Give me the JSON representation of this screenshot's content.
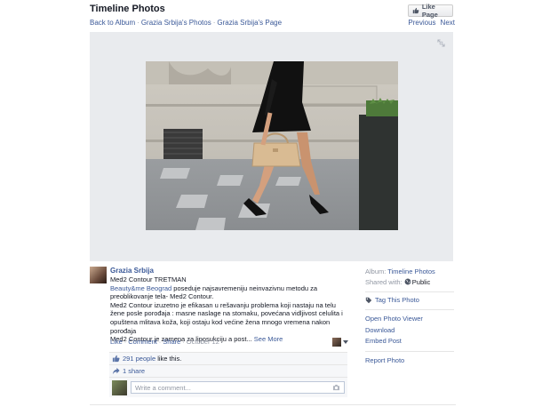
{
  "header": {
    "title": "Timeline Photos",
    "breadcrumbs": [
      "Back to Album",
      "Grazia Srbija's Photos",
      "Grazia Srbija's Page"
    ],
    "like_page_label": "Like Page",
    "prev_label": "Previous",
    "next_label": "Next"
  },
  "post": {
    "author": "Grazia Srbija",
    "line1": "Med2 Contour TRETMAN",
    "mention": "Beauty&me Beograd",
    "line2_rest": " poseduje najsavremeniju neinvazivnu metodu za preoblikovanje tela- Med2 Contour.",
    "line3": "Med2 Contour izuzetno je efikasan u rešavanju problema koji nastaju na telu žene posle porođaja : masne naslage na stomaku, povećana vidljivost celulita i opuštena mlitava koža, koji ostaju kod većine žena mnogo vremena nakon porođaja",
    "line4": "Med2 Contour je zamena za liposukciju a post...",
    "see_more": "See More",
    "actions": {
      "like": "Like",
      "comment": "Comment",
      "share": "Share",
      "date": "October 12"
    }
  },
  "ufi": {
    "likes_link": "291 people",
    "likes_rest": " like this.",
    "shares": "1 share",
    "comment_placeholder": "Write a comment..."
  },
  "sidebar": {
    "album_label": "Album:",
    "album_value": "Timeline Photos",
    "shared_label": "Shared with:",
    "shared_value": "Public",
    "tag_label": "Tag This Photo",
    "links": [
      "Open Photo Viewer",
      "Download",
      "Embed Post"
    ],
    "report": "Report Photo"
  },
  "icons": [
    "thumbs-up-icon",
    "expand-icon",
    "globe-icon",
    "tag-icon",
    "share-icon",
    "camera-icon",
    "caret-down-icon"
  ],
  "colors": {
    "link": "#3b5998",
    "stage_bg": "#e9ebee",
    "ufi_bg": "#f6f7f9"
  }
}
